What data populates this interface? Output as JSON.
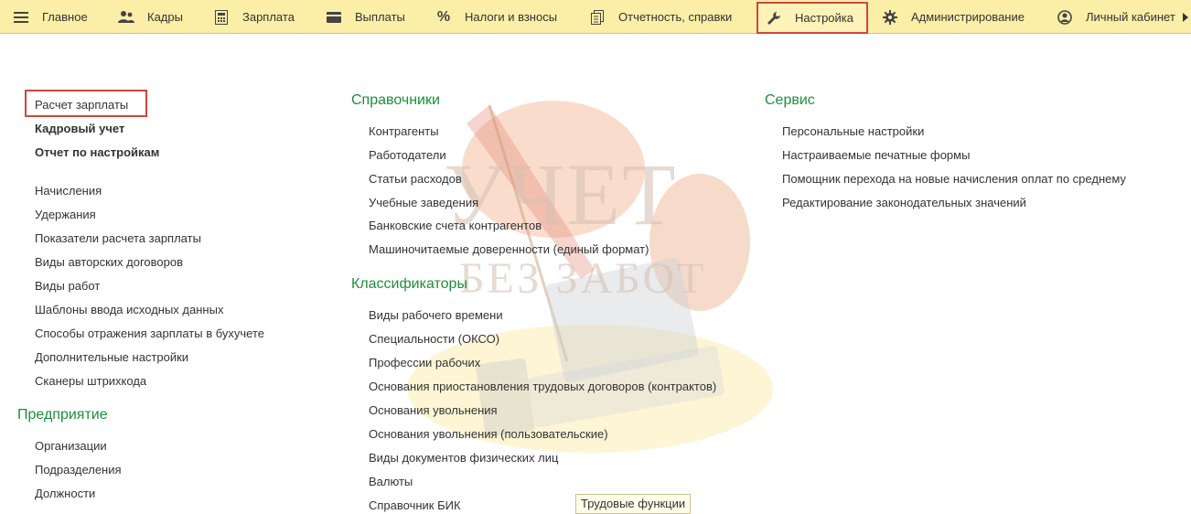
{
  "menu": {
    "items": [
      {
        "id": "main",
        "label": "Главное",
        "icon": "hamburger-icon"
      },
      {
        "id": "staff",
        "label": "Кадры",
        "icon": "people-icon"
      },
      {
        "id": "salary",
        "label": "Зарплата",
        "icon": "calculator-icon"
      },
      {
        "id": "payments",
        "label": "Выплаты",
        "icon": "wallet-icon"
      },
      {
        "id": "taxes",
        "label": "Налоги и взносы",
        "icon": "percent-icon"
      },
      {
        "id": "reports",
        "label": "Отчетность, справки",
        "icon": "documents-icon"
      },
      {
        "id": "settings",
        "label": "Настройка",
        "icon": "wrench-icon"
      },
      {
        "id": "admin",
        "label": "Администрирование",
        "icon": "gear-icon"
      },
      {
        "id": "account",
        "label": "Личный кабинет",
        "icon": "user-circle-icon"
      }
    ]
  },
  "watermark": {
    "line1": "УЧЕТ",
    "line2": "БЕЗ ЗАБОТ"
  },
  "left": {
    "top_links": [
      "Расчет зарплаты",
      "Кадровый учет",
      "Отчет по настройкам"
    ],
    "links": [
      "Начисления",
      "Удержания",
      "Показатели расчета зарплаты",
      "Виды авторских договоров",
      "Виды работ",
      "Шаблоны ввода исходных данных",
      "Способы отражения зарплаты в бухучете",
      "Дополнительные настройки",
      "Сканеры штрихкода"
    ],
    "enterprise_title": "Предприятие",
    "enterprise_links": [
      "Организации",
      "Подразделения",
      "Должности"
    ]
  },
  "middle": {
    "refs_title": "Справочники",
    "refs": [
      "Контрагенты",
      "Работодатели",
      "Статьи расходов",
      "Учебные заведения",
      "Банковские счета контрагентов",
      "Машиночитаемые доверенности (единый формат)"
    ],
    "class_title": "Классификаторы",
    "classifiers": [
      "Виды рабочего времени",
      "Специальности (ОКСО)",
      "Профессии рабочих",
      "Основания приостановления трудовых договоров (контрактов)",
      "Основания увольнения",
      "Основания увольнения (пользовательские)",
      "Виды документов физических лиц",
      "Валюты",
      "Справочник БИК"
    ],
    "tooltip": "Трудовые функции"
  },
  "right": {
    "service_title": "Сервис",
    "service": [
      "Персональные настройки",
      "Настраиваемые печатные формы",
      "Помощник перехода на новые начисления оплат по среднему",
      "Редактирование законодательных значений"
    ]
  }
}
